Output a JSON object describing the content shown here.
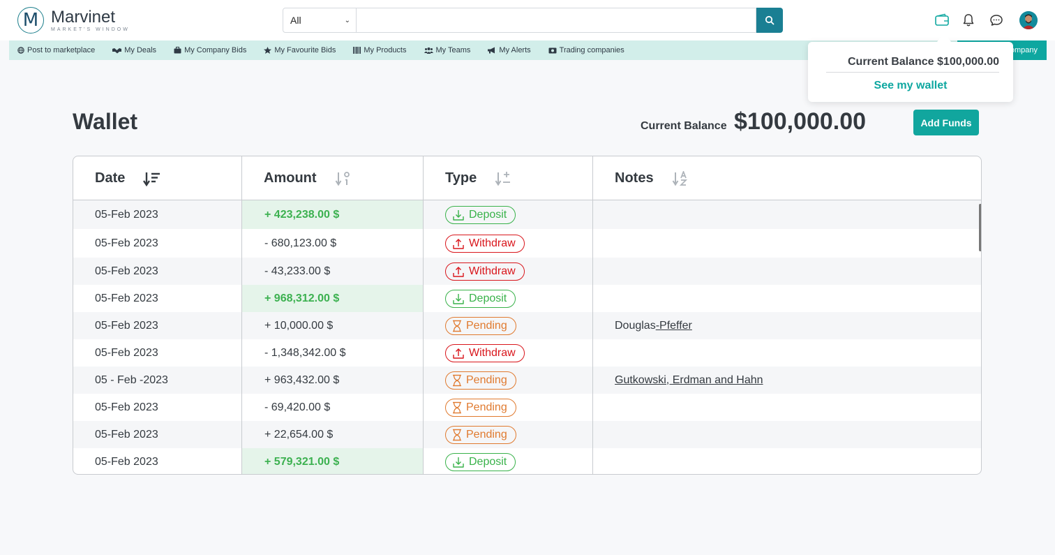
{
  "brand": {
    "logo_letter": "M",
    "name": "Marvinet",
    "tagline": "MARKET'S WINDOW"
  },
  "search": {
    "category": "All",
    "placeholder": ""
  },
  "nav": {
    "items": [
      {
        "label": "Post to marketplace",
        "icon": "globe-icon"
      },
      {
        "label": "My Deals",
        "icon": "handshake-icon"
      },
      {
        "label": "My Company Bids",
        "icon": "briefcase-icon"
      },
      {
        "label": "My Favourite Bids",
        "icon": "star-icon"
      },
      {
        "label": "My Products",
        "icon": "barcode-icon"
      },
      {
        "label": "My Teams",
        "icon": "users-icon"
      },
      {
        "label": "My Alerts",
        "icon": "megaphone-icon"
      },
      {
        "label": "Trading companies",
        "icon": "money-icon"
      }
    ],
    "company_label": "ompany"
  },
  "popup": {
    "balance": "Current Balance $100,000.00",
    "link": "See my wallet"
  },
  "wallet": {
    "title": "Wallet",
    "balance_label": "Current Balance",
    "balance_value": "$100,000.00",
    "add_funds": "Add Funds"
  },
  "table": {
    "headers": {
      "date": "Date",
      "amount": "Amount",
      "type": "Type",
      "notes": "Notes"
    },
    "rows": [
      {
        "date": "05-Feb 2023",
        "amount": "+ 423,238.00 $",
        "type": "Deposit",
        "notes": "",
        "notes_u": ""
      },
      {
        "date": "05-Feb 2023",
        "amount": "- 680,123.00 $",
        "type": "Withdraw",
        "notes": "",
        "notes_u": ""
      },
      {
        "date": "05-Feb 2023",
        "amount": "- 43,233.00 $",
        "type": "Withdraw",
        "notes": "",
        "notes_u": ""
      },
      {
        "date": "05-Feb 2023",
        "amount": "+ 968,312.00 $",
        "type": "Deposit",
        "notes": "",
        "notes_u": ""
      },
      {
        "date": "05-Feb 2023",
        "amount": "+ 10,000.00 $",
        "type": "Pending",
        "notes": "Douglas",
        "notes_u": "-Pfeffer"
      },
      {
        "date": "05-Feb 2023",
        "amount": "- 1,348,342.00 $",
        "type": "Withdraw",
        "notes": "",
        "notes_u": ""
      },
      {
        "date": "05 - Feb -2023",
        "amount": "+ 963,432.00 $",
        "type": "Pending",
        "notes": "",
        "notes_u": "Gutkowski, Erdman and Hahn"
      },
      {
        "date": "05-Feb 2023",
        "amount": "- 69,420.00 $",
        "type": "Pending",
        "notes": "",
        "notes_u": ""
      },
      {
        "date": "05-Feb 2023",
        "amount": "+ 22,654.00 $",
        "type": "Pending",
        "notes": "",
        "notes_u": ""
      },
      {
        "date": "05-Feb 2023",
        "amount": "+ 579,321.00 $",
        "type": "Deposit",
        "notes": "",
        "notes_u": ""
      }
    ]
  },
  "colors": {
    "accent": "#0ea7a0",
    "search_button": "#1a7f93",
    "deposit": "#39b24a",
    "withdraw": "#d9161c",
    "pending": "#e07a2f"
  }
}
